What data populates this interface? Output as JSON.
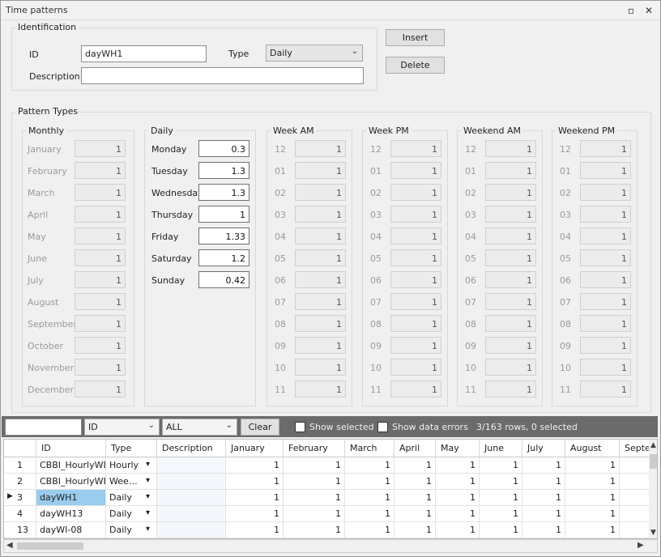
{
  "window": {
    "title": "Time patterns"
  },
  "identification": {
    "title": "Identification",
    "id_label": "ID",
    "id_value": "dayWH1",
    "type_label": "Type",
    "type_value": "Daily",
    "description_label": "Description",
    "description_value": ""
  },
  "actions": {
    "insert": "Insert",
    "delete": "Delete"
  },
  "pattern_types": {
    "title": "Pattern Types",
    "monthly": {
      "title": "Monthly",
      "rows": [
        {
          "label": "January",
          "value": "1"
        },
        {
          "label": "February",
          "value": "1"
        },
        {
          "label": "March",
          "value": "1"
        },
        {
          "label": "April",
          "value": "1"
        },
        {
          "label": "May",
          "value": "1"
        },
        {
          "label": "June",
          "value": "1"
        },
        {
          "label": "July",
          "value": "1"
        },
        {
          "label": "August",
          "value": "1"
        },
        {
          "label": "September",
          "value": "1"
        },
        {
          "label": "October",
          "value": "1"
        },
        {
          "label": "November",
          "value": "1"
        },
        {
          "label": "December",
          "value": "1"
        }
      ]
    },
    "daily": {
      "title": "Daily",
      "rows": [
        {
          "label": "Monday",
          "value": "0.3"
        },
        {
          "label": "Tuesday",
          "value": "1.3"
        },
        {
          "label": "Wednesday",
          "value": "1.3"
        },
        {
          "label": "Thursday",
          "value": "1"
        },
        {
          "label": "Friday",
          "value": "1.33"
        },
        {
          "label": "Saturday",
          "value": "1.2"
        },
        {
          "label": "Sunday",
          "value": "0.42"
        }
      ]
    },
    "hour_labels": [
      "12",
      "01",
      "02",
      "03",
      "04",
      "05",
      "06",
      "07",
      "08",
      "09",
      "10",
      "11"
    ],
    "hour_value": "1",
    "week_am": {
      "title": "Week AM"
    },
    "week_pm": {
      "title": "Week PM"
    },
    "weekend_am": {
      "title": "Weekend AM"
    },
    "weekend_pm": {
      "title": "Weekend PM"
    }
  },
  "filter": {
    "search_value": "",
    "field_value": "ID",
    "scope_value": "ALL",
    "clear": "Clear",
    "show_selected": "Show selected",
    "show_errors": "Show data errors",
    "status": "3/163 rows, 0 selected"
  },
  "grid": {
    "headers": [
      "",
      "ID",
      "Type",
      "Description",
      "January",
      "February",
      "March",
      "April",
      "May",
      "June",
      "July",
      "August",
      "Septe"
    ],
    "rows": [
      {
        "num": "1",
        "id": "CBBI_HourlyWD",
        "type": "Hourly",
        "desc": "",
        "vals": [
          "1",
          "1",
          "1",
          "1",
          "1",
          "1",
          "1",
          "1"
        ]
      },
      {
        "num": "2",
        "id": "CBBI_HourlyWE",
        "type": "Wee…",
        "desc": "",
        "vals": [
          "1",
          "1",
          "1",
          "1",
          "1",
          "1",
          "1",
          "1"
        ]
      },
      {
        "num": "3",
        "id": "dayWH1",
        "type": "Daily",
        "desc": "",
        "vals": [
          "1",
          "1",
          "1",
          "1",
          "1",
          "1",
          "1",
          "1"
        ]
      },
      {
        "num": "4",
        "id": "dayWH13",
        "type": "Daily",
        "desc": "",
        "vals": [
          "1",
          "1",
          "1",
          "1",
          "1",
          "1",
          "1",
          "1"
        ]
      },
      {
        "num": "13",
        "id": "dayWI-08",
        "type": "Daily",
        "desc": "",
        "vals": [
          "1",
          "1",
          "1",
          "1",
          "1",
          "1",
          "1",
          "1"
        ]
      }
    ]
  }
}
